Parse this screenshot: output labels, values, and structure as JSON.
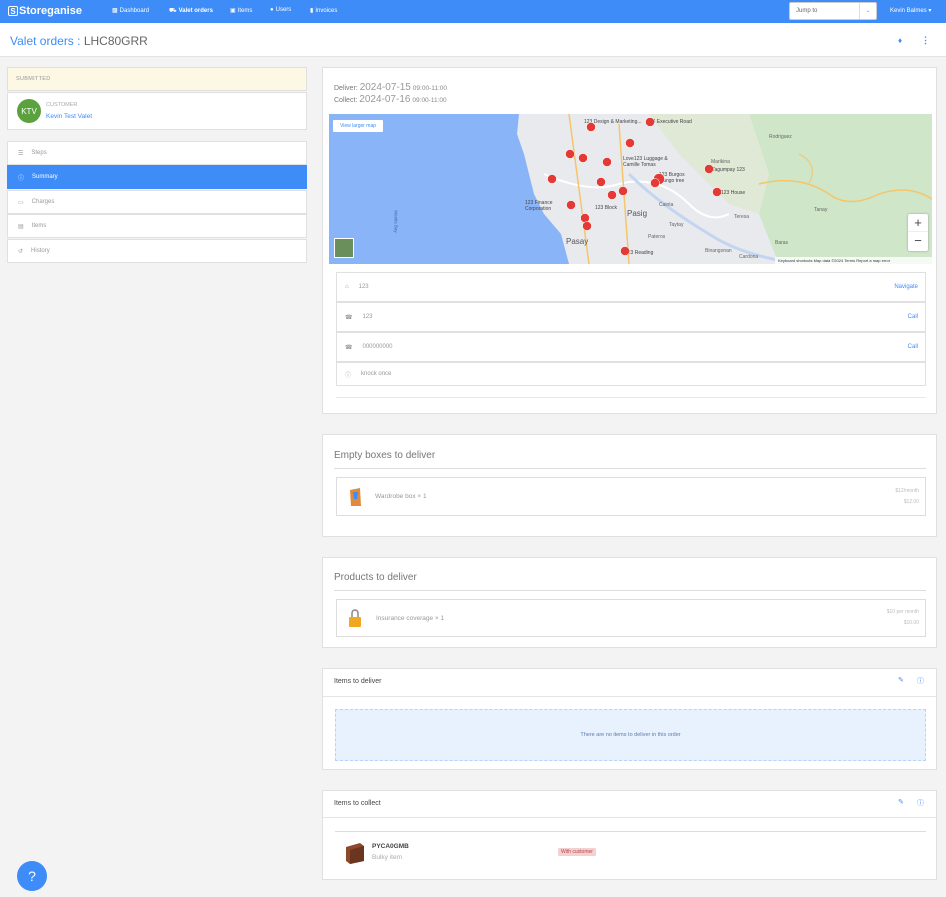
{
  "nav": {
    "brand": "Storeganise",
    "links": [
      {
        "label": "Dashboard",
        "icon": "dashboard-icon"
      },
      {
        "label": "Valet orders",
        "icon": "truck-icon"
      },
      {
        "label": "Items",
        "icon": "archive-icon"
      },
      {
        "label": "Users",
        "icon": "user-icon"
      },
      {
        "label": "Invoices",
        "icon": "file-icon"
      }
    ],
    "jump_placeholder": "Jump to",
    "user_name": "Kevin Balmes"
  },
  "header": {
    "title_prefix": "Valet orders :",
    "order_code": "LHC80GRR"
  },
  "sidebar": {
    "status": "SUBMITTED",
    "customer_label": "CUSTOMER",
    "customer_name": "Kevin Test Valet",
    "avatar_initials": "KTV",
    "items": [
      {
        "label": "Steps",
        "icon": "list-icon"
      },
      {
        "label": "Summary",
        "icon": "info-icon",
        "active": true
      },
      {
        "label": "Charges",
        "icon": "card-icon"
      },
      {
        "label": "Items",
        "icon": "archive-icon"
      },
      {
        "label": "History",
        "icon": "history-icon"
      }
    ]
  },
  "schedule": {
    "deliver_label": "Deliver:",
    "deliver_date": "2024-07-15",
    "deliver_time": "09:00-11:00",
    "collect_label": "Collect:",
    "collect_date": "2024-07-16",
    "collect_time": "09:00-11:00"
  },
  "map": {
    "view_larger": "View larger map",
    "zoom_in": "+",
    "zoom_out": "−",
    "footer": "Keyboard shortcuts   Map data ©2024   Terms   Report a map error",
    "labels": [
      "123 Design & Marketing...",
      "123 Executive Road",
      "Love123 Luggage & Camille Tomas",
      "123 Burgos Mango tree",
      "Tagumpay 123",
      "123 House",
      "123 Finance Corporation",
      "123 Block",
      "Pasig",
      "Pasay",
      "Cainta",
      "Taytay",
      "Marikina",
      "Tanay",
      "Teresa",
      "Baras",
      "Manila Bay",
      "Pateros",
      "Binangonan",
      "Cardona",
      "Rodriguez",
      "123 Reading"
    ]
  },
  "contacts": [
    {
      "icon": "location-icon",
      "text": "123",
      "action": "Navigate"
    },
    {
      "icon": "phone-icon",
      "text": "123",
      "action": "Call"
    },
    {
      "icon": "phone-icon",
      "text": "000000000",
      "action": "Call"
    },
    {
      "icon": "info-icon",
      "text": "knock once",
      "action": ""
    }
  ],
  "empty_boxes": {
    "title": "Empty boxes to deliver",
    "item": "Wardrobe box × 1",
    "price_unit": "$12/month",
    "price_total": "$12.00"
  },
  "products": {
    "title": "Products to deliver",
    "item": "Insurance coverage × 1",
    "price_unit": "$10 per month",
    "price_total": "$10.00"
  },
  "items_deliver": {
    "title": "Items to deliver",
    "empty_msg": "There are no items to deliver in this order"
  },
  "items_collect": {
    "title": "Items to collect",
    "rows": [
      {
        "code": "PYCA0GMB",
        "type": "Bulky item",
        "badge": "With customer"
      }
    ]
  },
  "colors": {
    "primary": "#3d8cf7",
    "avatar": "#5ba23f",
    "status_bg": "#fcf8e3",
    "badge_bg": "#f5d0d0"
  }
}
